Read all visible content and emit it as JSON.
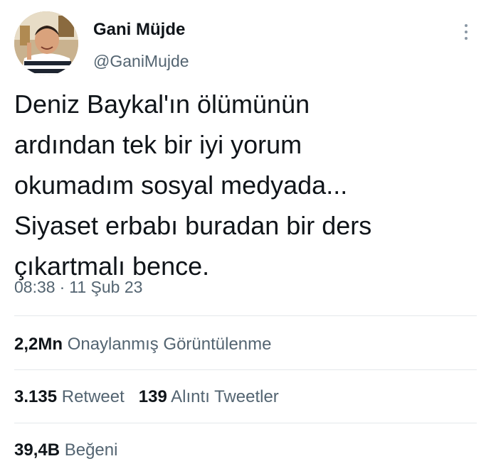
{
  "author": {
    "name": "Gani Müjde",
    "handle": "@GaniMujde"
  },
  "tweet": {
    "text": "Deniz Baykal'ın ölümünün\nardından tek bir iyi yorum\nokumadım sosyal medyada...\nSiyaset erbabı buradan bir ders\nçıkartmalı bence.",
    "time": "08:38",
    "separator": "·",
    "date": "11 Şub 23"
  },
  "stats": {
    "views_count": "2,2Mn",
    "views_label": "Onaylanmış Görüntülenme",
    "retweets_count": "3.135",
    "retweets_label": "Retweet",
    "quotes_count": "139",
    "quotes_label": "Alıntı Tweetler",
    "likes_count": "39,4B",
    "likes_label": "Beğeni"
  },
  "icons": {
    "more": "more-options-icon"
  }
}
